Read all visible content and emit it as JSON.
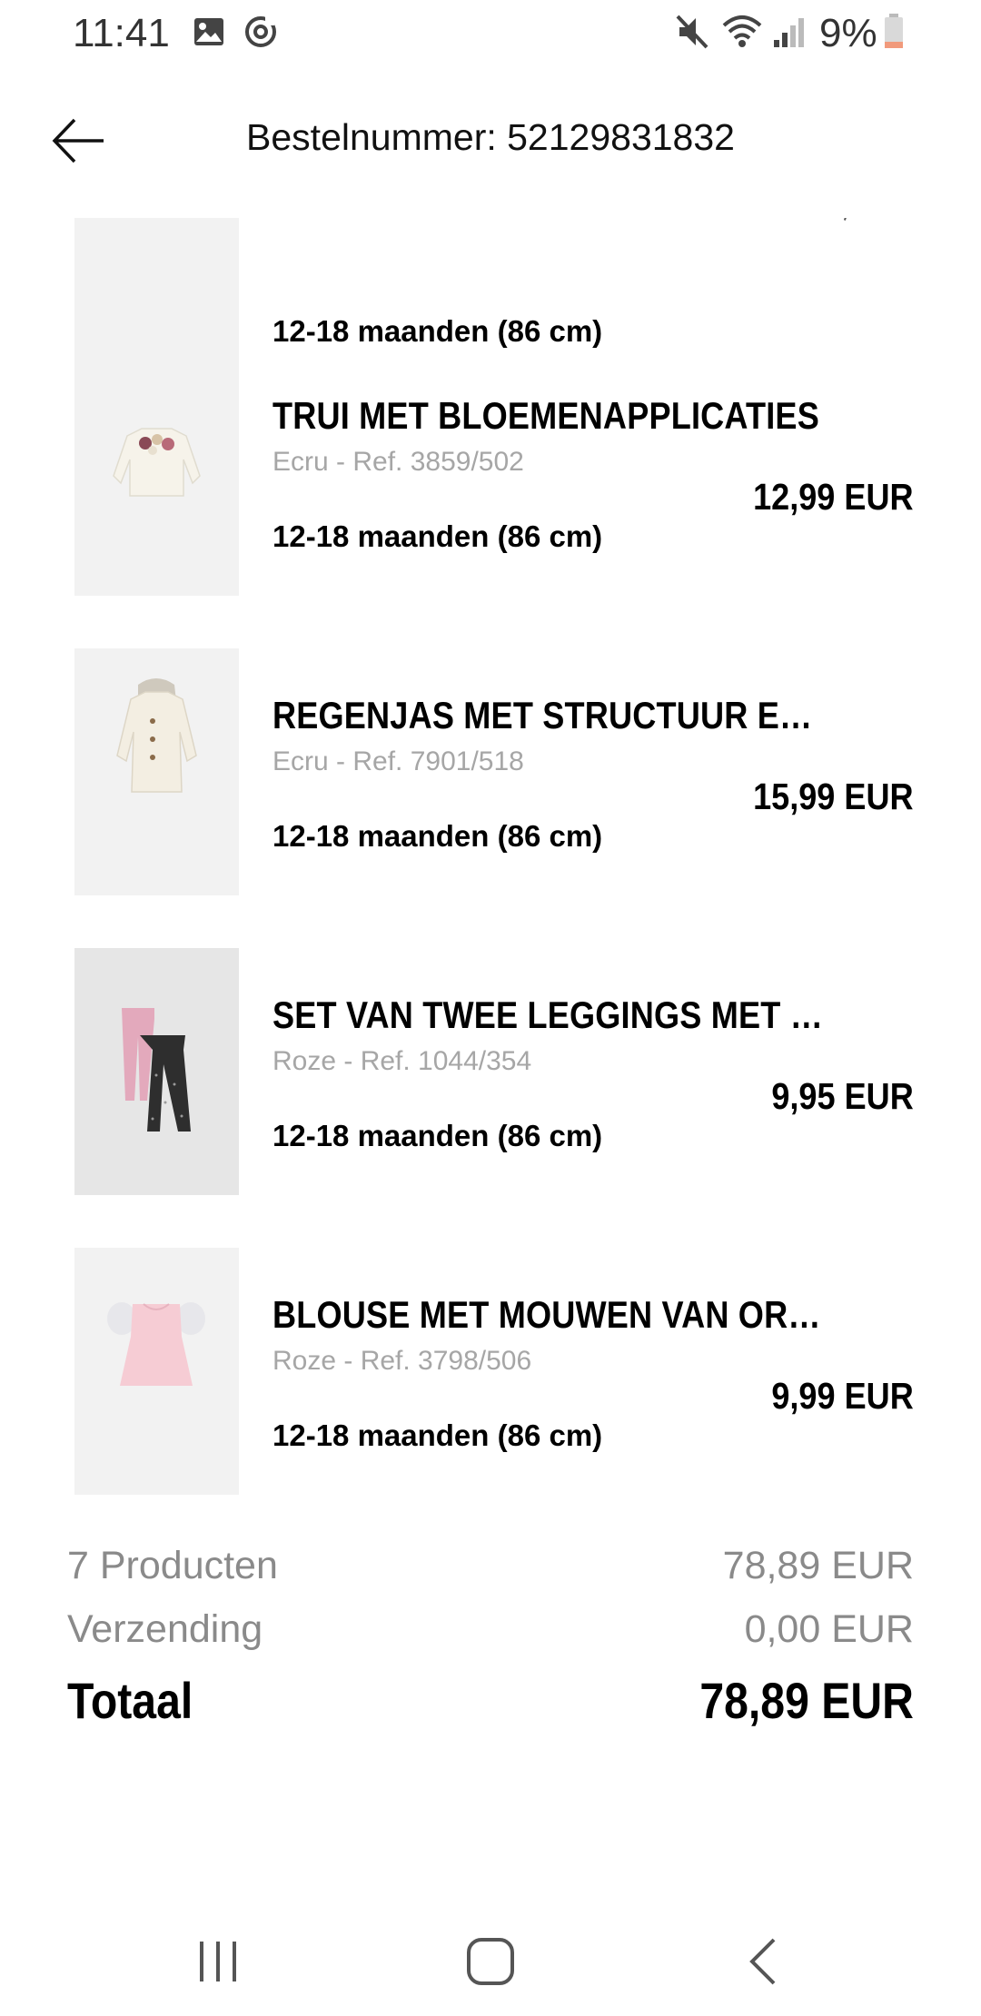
{
  "status_bar": {
    "time": "11:41",
    "battery": "9%",
    "icons": [
      "gallery-icon",
      "sync-icon",
      "mute-icon",
      "wifi-icon",
      "signal-icon",
      "battery-icon"
    ]
  },
  "header": {
    "title": "Bestelnummer: 52129831832",
    "back_icon": "arrow-left-icon"
  },
  "items": [
    {
      "name": "",
      "ref": "",
      "price": "",
      "size": "12-18 maanden (86 cm)"
    },
    {
      "name": "TRUI MET BLOEMENAPPLICATIES",
      "ref": "Ecru - Ref. 3859/502",
      "price": "12,99 EUR",
      "size": "12-18 maanden (86 cm)"
    },
    {
      "name": "REGENJAS MET STRUCTUUR EN GESTIKTE CAPUCHON",
      "ref": "Ecru - Ref. 7901/518",
      "price": "15,99 EUR",
      "size": "12-18 maanden (86 cm)"
    },
    {
      "name": "SET VAN TWEE LEGGINGS MET PRINT",
      "ref": "Roze - Ref. 1044/354",
      "price": "9,95 EUR",
      "size": "12-18 maanden (86 cm)"
    },
    {
      "name": "BLOUSE MET MOUWEN VAN ORGANZA",
      "ref": "Roze - Ref. 3798/506",
      "price": "9,99 EUR",
      "size": "12-18 maanden (86 cm)"
    }
  ],
  "summary": {
    "products_label": "7 Producten",
    "products_value": "78,89 EUR",
    "shipping_label": "Verzending",
    "shipping_value": "0,00 EUR",
    "total_label": "Totaal",
    "total_value": "78,89 EUR"
  },
  "navbar": {
    "icons": [
      "recent-apps-icon",
      "home-icon",
      "back-icon"
    ]
  }
}
